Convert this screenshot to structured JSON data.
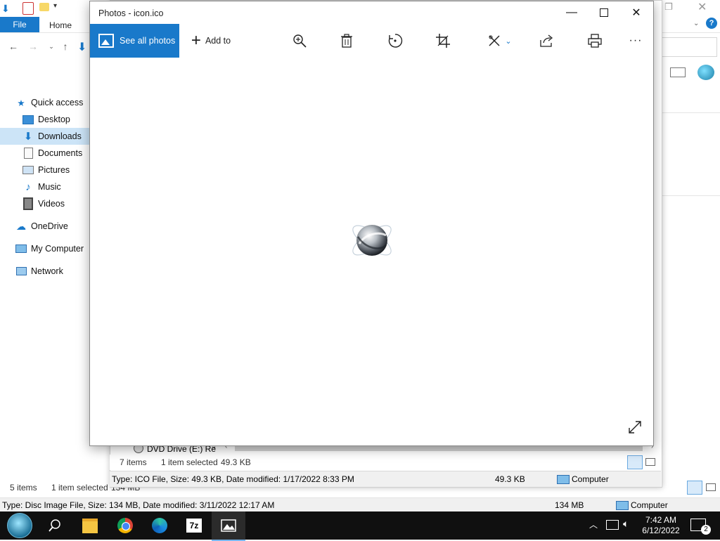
{
  "explorer_back": {
    "tabs": {
      "file": "File",
      "home": "Home"
    },
    "sidebar": [
      {
        "label": "Quick access",
        "icon": "star-icon"
      },
      {
        "label": "Desktop",
        "icon": "desktop-folder-icon"
      },
      {
        "label": "Downloads",
        "icon": "download-arrow-icon",
        "selected": true
      },
      {
        "label": "Documents",
        "icon": "documents-icon"
      },
      {
        "label": "Pictures",
        "icon": "pictures-icon"
      },
      {
        "label": "Music",
        "icon": "music-note-icon"
      },
      {
        "label": "Videos",
        "icon": "film-icon"
      },
      {
        "label": "OneDrive",
        "icon": "cloud-icon"
      },
      {
        "label": "My Computer",
        "icon": "computer-icon"
      },
      {
        "label": "Network",
        "icon": "network-icon"
      }
    ],
    "status": {
      "items": "5 items",
      "selected": "1 item selected",
      "size": "134 MB"
    },
    "details": {
      "text": "Type: Disc Image File, Size: 134 MB, Date modified: 3/11/2022 12:17 AM",
      "size": "134 MB",
      "location": "Computer"
    }
  },
  "explorer_front": {
    "drive_label": "DVD Drive (E:) Re",
    "status": {
      "items": "7 items",
      "selected": "1 item selected",
      "size": "49.3 KB"
    },
    "details": {
      "text": "Type: ICO File, Size: 49.3 KB, Date modified: 1/17/2022 8:33 PM",
      "size": "49.3 KB",
      "location": "Computer"
    }
  },
  "photos": {
    "title": "Photos - icon.ico",
    "see_all": "See all photos",
    "add_to": "Add to",
    "toolbar_icons": [
      "zoom-icon",
      "delete-icon",
      "rotate-icon",
      "crop-icon",
      "edit-draw-icon",
      "share-icon",
      "print-icon",
      "more-icon"
    ],
    "fullscreen_icon": "expand-icon"
  },
  "taskbar": {
    "apps": [
      "start-icon",
      "search-icon",
      "file-explorer-icon",
      "chrome-icon",
      "edge-icon",
      "7zip-icon",
      "photos-icon"
    ],
    "seven_zip_label": "7z",
    "time": "7:42 AM",
    "date": "6/12/2022",
    "notifications": "2"
  },
  "colors": {
    "accent": "#1979ca",
    "selection": "#cce4f7",
    "taskbar": "#101010"
  }
}
